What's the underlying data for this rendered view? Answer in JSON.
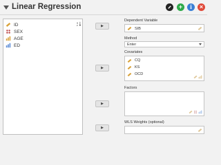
{
  "header": {
    "title": "Linear Regression"
  },
  "variables": [
    {
      "name": "ID",
      "type": "nominal-text"
    },
    {
      "name": "SEX",
      "type": "nominal"
    },
    {
      "name": "AGE",
      "type": "scale"
    },
    {
      "name": "ED",
      "type": "ordinal"
    }
  ],
  "sections": {
    "dependent": {
      "label": "Dependent Variable",
      "value": "SIB"
    },
    "method": {
      "label": "Method",
      "value": "Enter"
    },
    "covariates": {
      "label": "Covariates",
      "items": [
        "CQ",
        "KS",
        "OCD"
      ]
    },
    "factors": {
      "label": "Factors"
    },
    "wls": {
      "label": "WLS Weights (optional)"
    }
  },
  "colors": {
    "edit": "#222222",
    "add": "#2eaa4a",
    "info": "#3a7fd5",
    "close": "#e04a3a",
    "ruler": "#d9a23a"
  }
}
